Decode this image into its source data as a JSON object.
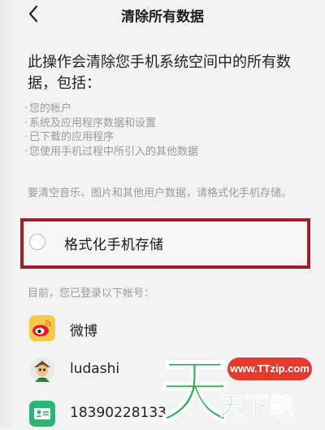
{
  "header": {
    "title": "清除所有数据",
    "back_icon": "chevron-left-icon"
  },
  "intro": "此操作会清除您手机系统空间中的所有数据，包括：",
  "bullets": [
    "您的帐户",
    "系统及应用程序数据和设置",
    "已下载的应用程序",
    "您使用手机过程中所引入的其他数据"
  ],
  "note": "要清空音乐、图片和其他用户数据，请格式化手机存储。",
  "format_option": {
    "label": "格式化手机存储",
    "checked": false,
    "highlight_color": "#a01f2b"
  },
  "accounts": {
    "title": "目前，您已登录以下帐号：",
    "items": [
      {
        "name": "微博",
        "icon": "weibo-icon"
      },
      {
        "name": "ludashi",
        "icon": "ludashi-avatar-icon"
      },
      {
        "name": "18390228133",
        "icon": "contact-card-icon"
      }
    ]
  },
  "watermark": {
    "brand_char": "天",
    "url": "www.TTzip.com",
    "subtitle": "天下载",
    "green": "#29b24f",
    "red": "#e73a2f"
  }
}
